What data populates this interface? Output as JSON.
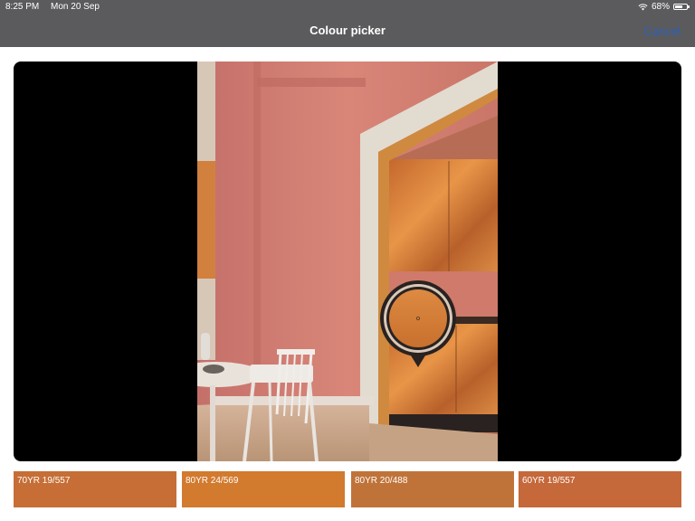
{
  "status": {
    "time": "8:25 PM",
    "date": "Mon 20 Sep",
    "battery": "68%",
    "battery_level": 0.68
  },
  "nav": {
    "title": "Colour picker",
    "cancel_label": "Cancel"
  },
  "icons": {
    "wifi": "wifi-icon",
    "battery": "battery-icon",
    "picker": "colour-picker-lens-icon"
  },
  "swatches": [
    {
      "code": "70YR 19/557",
      "color": "#c66e35"
    },
    {
      "code": "80YR 24/569",
      "color": "#d27a2e"
    },
    {
      "code": "80YR 20/488",
      "color": "#c07339"
    },
    {
      "code": "60YR 19/557",
      "color": "#c5683a"
    }
  ],
  "colors": {
    "bar": "#5b5b5d",
    "accent": "#2a5fbb",
    "wall": "#cf7c70"
  }
}
